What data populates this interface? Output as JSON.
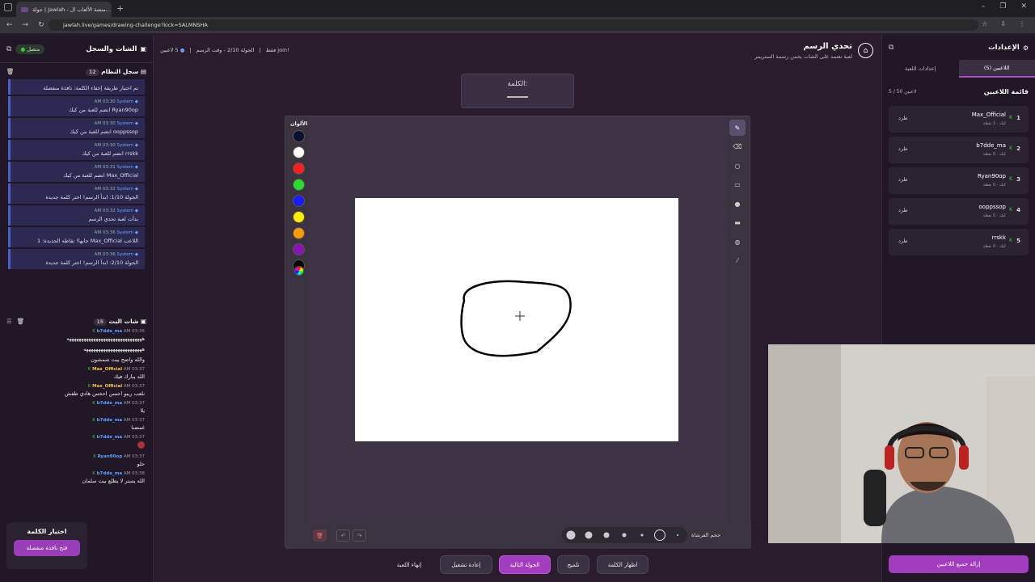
{
  "browser": {
    "tab_title": "جولة | Jawlah - منصة الألعاب ال...",
    "url": "jawlah.live/games/drawing-challenge?kick=SALMNSHA"
  },
  "left_panel": {
    "title": "الشات والسجل",
    "status": "متصل",
    "system_log": {
      "title": "سجل النظام",
      "count": "12",
      "items": [
        {
          "sender": "",
          "time": "",
          "text": "تم اختيار طريقة إخفاء الكلمة: نافذة منفصلة"
        },
        {
          "sender": "System",
          "time": "AM 03:30",
          "text": "Ryan90op انضم للعبة من كيك"
        },
        {
          "sender": "System",
          "time": "AM 03:30",
          "text": "ooppssop انضم للعبة من كيك"
        },
        {
          "sender": "System",
          "time": "AM 03:30",
          "text": "rrskk انضم للعبة من كيك"
        },
        {
          "sender": "System",
          "time": "AM 03:31",
          "text": "Max_Official انضم للعبة من كيك"
        },
        {
          "sender": "System",
          "time": "AM 03:32",
          "text": "الجولة 1/10: ابدأ الرسم! اختر كلمة جديدة"
        },
        {
          "sender": "System",
          "time": "AM 03:32",
          "text": "بدأت لعبة تحدي الرسم"
        },
        {
          "sender": "System",
          "time": "AM 03:36",
          "text": "اللاعب Max_Official جابها! نقاطه الجديدة: 1"
        },
        {
          "sender": "System",
          "time": "AM 03:36",
          "text": "الجولة 2/10: ابدأ الرسم! اختر كلمة جديدة"
        }
      ]
    },
    "stream_chat": {
      "title": "شات البث",
      "count": "15",
      "messages": [
        {
          "name": "b7dde_ma",
          "time": "AM 03:36",
          "text": "هههههههههههههههههههههههههههههههه"
        },
        {
          "name": "",
          "time": "",
          "text": "ههههههههههههههههههههههههه"
        },
        {
          "name": "",
          "time": "",
          "text": "والله واضح بيت شمشون"
        },
        {
          "name": "Max_Official",
          "time": "AM 03:37",
          "text": "الله يبارك فيك"
        },
        {
          "name": "Max_Official",
          "time": "AM 03:37",
          "text": "نلعب ريبو احسن احخس هادي طفش"
        },
        {
          "name": "b7dde_ma",
          "time": "AM 03:37",
          "text": "يلا"
        },
        {
          "name": "b7dde_ma",
          "time": "AM 03:37",
          "text": "غمضنا"
        },
        {
          "name": "b7dde_ma",
          "time": "AM 03:37",
          "text": ""
        },
        {
          "name": "Ryan90op",
          "time": "AM 03:37",
          "text": "حلو"
        },
        {
          "name": "b7dde_ma",
          "time": "AM 03:38",
          "text": "الله يستر لا يطلع بيت سلمان"
        }
      ]
    },
    "choose_word": {
      "title": "اختيار الكلمة",
      "button": "فتح نافذة منفصلة"
    }
  },
  "game": {
    "title": "تحدي الرسم",
    "subtitle": "لعبة تعتمد على الشات يخمن رسمة الستريمر",
    "players_count": "5 لاعبين",
    "round": "الجولة 2/10",
    "draw_time": "وقت الرسم",
    "join_hint": "!join فقط",
    "word_label": "الكلمة:",
    "palette_label": "الألوان",
    "palette": [
      "#0b1030",
      "#ffffff",
      "#ff1f1f",
      "#2bdc2b",
      "#1b1bff",
      "#ffee00",
      "#ff9a00",
      "#8a13b8",
      "#000000"
    ],
    "brush_size_label": "حجم الفرشاة",
    "tools": [
      "pencil-icon",
      "eraser-icon",
      "circle-icon",
      "rect-icon",
      "dot-icon",
      "fill-rect-icon",
      "bucket-icon",
      "line-icon"
    ],
    "actions": {
      "end_game": "إنهاء اللعبة",
      "restart": "إعادة تشغيل",
      "next_round": "الجولة التالية",
      "hint": "تلميح",
      "show_word": "اظهار الكلمة"
    }
  },
  "right_panel": {
    "title": "الإعدادات",
    "tabs": [
      "إعدادات اللعبة",
      "اللاعبين (5)"
    ],
    "players_title": "قائمة اللاعبين",
    "players_count": "5 / 50 لاعبين",
    "kick_label": "طرد",
    "players": [
      {
        "rank": "1",
        "name": "Max_Official",
        "stat": "كيك · 1 نقطة"
      },
      {
        "rank": "2",
        "name": "b7dde_ma",
        "stat": "كيك · 0 نقطة"
      },
      {
        "rank": "3",
        "name": "Ryan90op",
        "stat": "كيك · 0 نقطة"
      },
      {
        "rank": "4",
        "name": "ooppssop",
        "stat": "كيك · 0 نقطة"
      },
      {
        "rank": "5",
        "name": "rrskk",
        "stat": "كيك · 0 نقطة"
      }
    ],
    "remove_all": "إزالة جميع اللاعبين"
  }
}
